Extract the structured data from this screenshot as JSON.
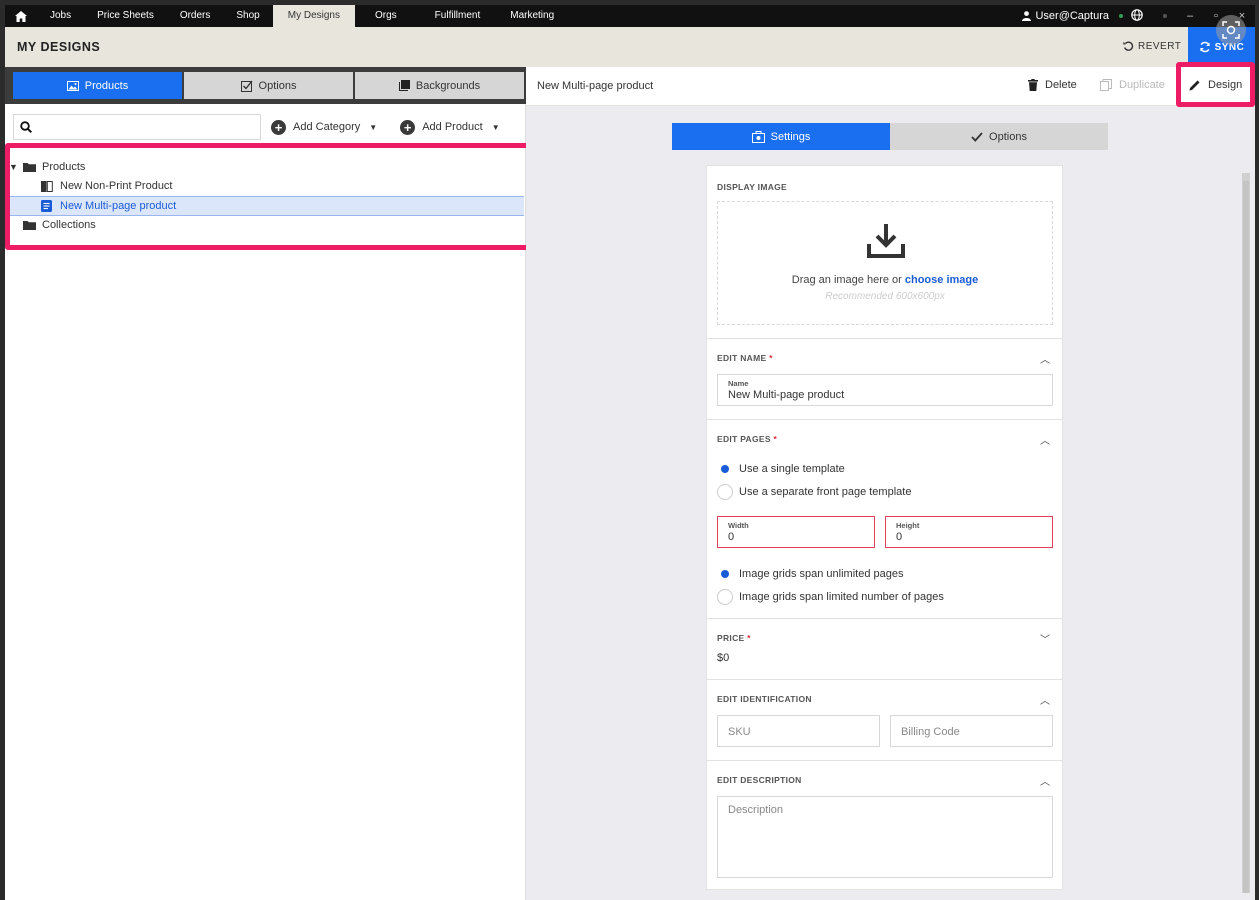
{
  "topnav": {
    "items": [
      "Jobs",
      "Price Sheets",
      "Orders",
      "Shop",
      "My Designs",
      "Orgs",
      "Fulfillment",
      "Marketing"
    ],
    "user": "User@Captura"
  },
  "header": {
    "title": "MY DESIGNS",
    "revert_label": "REVERT",
    "sync_label": "SYNC"
  },
  "left": {
    "tabs": [
      "Products",
      "Options",
      "Backgrounds"
    ],
    "search_placeholder": "",
    "add_category_label": "Add Category",
    "add_product_label": "Add Product",
    "tree": {
      "products_folder": "Products",
      "item1": "New Non-Print Product",
      "item2": "New Multi-page product",
      "collections_folder": "Collections"
    }
  },
  "right": {
    "title": "New Multi-page product",
    "delete_label": "Delete",
    "duplicate_label": "Duplicate",
    "design_label": "Design",
    "tabs": [
      "Settings",
      "Options"
    ],
    "display_image": {
      "title": "DISPLAY IMAGE",
      "drag_text": "Drag an image here or ",
      "choose_link": "choose image",
      "recommended": "Recommended 600x600px"
    },
    "edit_name": {
      "title": "EDIT NAME",
      "field_label": "Name",
      "field_value": "New Multi-page product"
    },
    "edit_pages": {
      "title": "EDIT PAGES",
      "radio1": "Use a single template",
      "radio2": "Use a separate front page template",
      "width_label": "Width",
      "width_value": "0",
      "height_label": "Height",
      "height_value": "0",
      "radio3": "Image grids span unlimited pages",
      "radio4": "Image grids span limited number of pages"
    },
    "price": {
      "title": "PRICE",
      "value": "$0"
    },
    "edit_identification": {
      "title": "EDIT IDENTIFICATION",
      "sku_placeholder": "SKU",
      "billing_placeholder": "Billing Code"
    },
    "edit_description": {
      "title": "EDIT DESCRIPTION",
      "description_placeholder": "Description"
    }
  },
  "colors": {
    "accent": "#1a6ef0",
    "highlight": "#ee1c64",
    "required": "#e0263a"
  }
}
